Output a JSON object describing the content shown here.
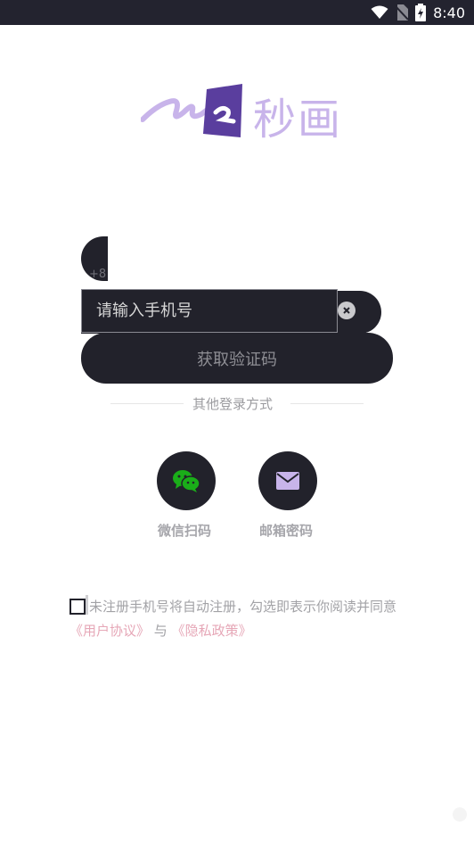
{
  "status_bar": {
    "time": "8:40"
  },
  "logo": {
    "text": "秒画"
  },
  "phone": {
    "country_code": "+86",
    "placeholder": "请输入手机号",
    "value": ""
  },
  "get_code_label": "获取验证码",
  "other_login_label": "其他登录方式",
  "social": [
    {
      "label": "微信扫码",
      "icon": "wechat-icon"
    },
    {
      "label": "邮箱密码",
      "icon": "mail-icon"
    }
  ],
  "agreement": {
    "prefix": "未注册手机号将自动注册，勾选即表示你阅读并同意",
    "user_agreement": "《用户协议》",
    "connector": " 与 ",
    "privacy_policy": "《隐私政策》"
  },
  "colors": {
    "accent_purple": "#5a3e9e",
    "logo_light": "#c8b4ea",
    "dark": "#22222b",
    "link_pink": "#e6a7b7",
    "wechat_green": "#1aad19"
  }
}
